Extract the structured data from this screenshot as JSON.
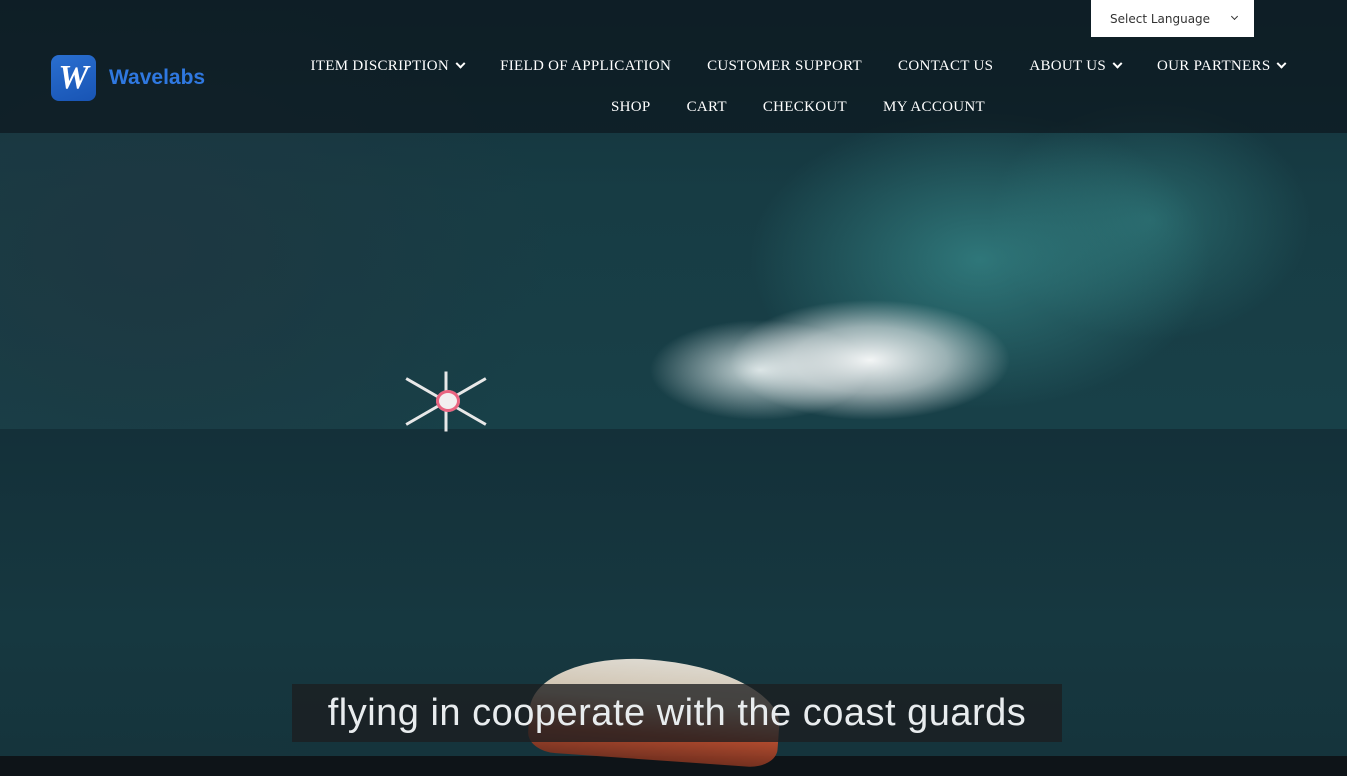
{
  "header": {
    "logo_letter": "W",
    "logo_text": "Wavelabs",
    "language_select": "Select Language",
    "nav_row1": [
      {
        "label": "ITEM DISCRIPTION",
        "dropdown": true
      },
      {
        "label": "FIELD OF APPLICATION",
        "dropdown": false
      },
      {
        "label": "CUSTOMER SUPPORT",
        "dropdown": false
      },
      {
        "label": "CONTACT US",
        "dropdown": false
      },
      {
        "label": "ABOUT US",
        "dropdown": true
      },
      {
        "label": "OUR PARTNERS",
        "dropdown": true
      }
    ],
    "nav_row2": [
      {
        "label": "SHOP"
      },
      {
        "label": "CART"
      },
      {
        "label": "CHECKOUT"
      },
      {
        "label": "MY ACCOUNT"
      }
    ]
  },
  "hero": {
    "subtitle": "flying in cooperate with the coast guards"
  },
  "colors": {
    "brand": "#2f78e0",
    "header_bg": "#0c181e",
    "nav_text": "#ffffff"
  }
}
